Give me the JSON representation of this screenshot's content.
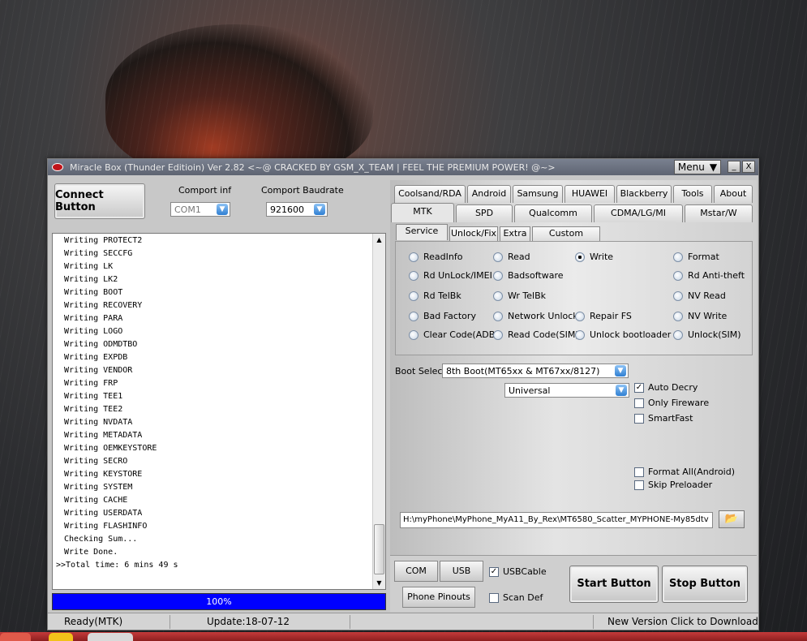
{
  "window": {
    "title": "Miracle Box (Thunder Editioin) Ver 2.82 <~@ CRACKED BY GSM_X_TEAM | FEEL THE PREMIUM POWER! @~>",
    "menu_label": "Menu",
    "minimize_glyph": "_",
    "close_glyph": "X"
  },
  "connection": {
    "connect_button": "Connect Button",
    "comport_label": "Comport inf",
    "comport_value": "COM1",
    "baud_label": "Comport Baudrate",
    "baud_value": "921600"
  },
  "log": {
    "lines": [
      "Writing PROTECT2",
      "Writing SECCFG",
      "Writing LK",
      "Writing LK2",
      "Writing BOOT",
      "Writing RECOVERY",
      "Writing PARA",
      "Writing LOGO",
      "Writing ODMDTBO",
      "Writing EXPDB",
      "Writing VENDOR",
      "Writing FRP",
      "Writing TEE1",
      "Writing TEE2",
      "Writing NVDATA",
      "Writing METADATA",
      "Writing OEMKEYSTORE",
      "Writing SECRO",
      "Writing KEYSTORE",
      "Writing SYSTEM",
      "Writing CACHE",
      "Writing USERDATA",
      "Writing FLASHINFO",
      "Checking Sum...",
      "Write Done."
    ],
    "last_line": ">>Total time: 6 mins 49 s"
  },
  "progress": {
    "value": 100,
    "label": "100%"
  },
  "status_bar": {
    "state": "Ready(MTK)",
    "update": "Update:18-07-12",
    "new_version": "New Version Click to Download"
  },
  "tabs_row1": [
    "Coolsand/RDA",
    "Android",
    "Samsung",
    "HUAWEI",
    "Blackberry",
    "Tools",
    "About"
  ],
  "tabs_row2": [
    "MTK",
    "SPD",
    "Qualcomm",
    "CDMA/LG/MI",
    "Mstar/W"
  ],
  "active_tab": "MTK",
  "subtabs": [
    "Service",
    "Unlock/Fix",
    "Extra",
    "Custom Setting"
  ],
  "active_subtab": "Service",
  "service_options": [
    "ReadInfo",
    "Read",
    "Write",
    "Format",
    "Rd UnLock/IMEI",
    "Badsoftware",
    "Rd Anti-theft",
    "Rd TelBk",
    "Wr TelBk",
    "NV Read",
    "Bad Factory",
    "Network Unlock",
    "Repair FS",
    "NV Write",
    "Clear Code(ADB)",
    "Read Code(SIM)",
    "Unlock bootloader",
    "Unlock(SIM)"
  ],
  "selected_option": "Write",
  "boot": {
    "label": "Boot Select:",
    "value": "8th Boot(MT65xx & MT67xx/8127)",
    "mode_value": "Universal"
  },
  "options": {
    "auto_decry": {
      "label": "Auto Decry",
      "checked": true
    },
    "only_fireware": {
      "label": "Only Fireware",
      "checked": false
    },
    "smart_fast": {
      "label": "SmartFast",
      "checked": false
    },
    "format_all": {
      "label": "Format All(Android)",
      "checked": false
    },
    "skip_preloader": {
      "label": "Skip Preloader",
      "checked": false
    }
  },
  "scatter_path": "H:\\myPhone\\MyPhone_MyA11_By_Rex\\MT6580_Scatter_MYPHONE-My85dtv",
  "bottom": {
    "com_scan": "COM Scan",
    "usb_scan": "USB Scan",
    "usb_cable": {
      "label": "USBCable",
      "checked": true
    },
    "phone_pinouts": "Phone Pinouts",
    "scan_def": {
      "label": "Scan Def",
      "checked": false
    },
    "start_button": "Start Button",
    "stop_button": "Stop Button"
  },
  "colors": {
    "progress": "#0000ff",
    "taskbar": "#b02a2a",
    "titlebar": "#6b7180"
  }
}
